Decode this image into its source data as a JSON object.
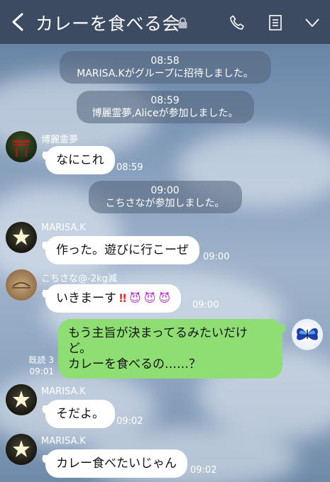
{
  "header": {
    "title": "カレーを食べる会"
  },
  "colors": {
    "header_bg": "#3c4a62",
    "bubble_self": "#8fde73",
    "bubble_other": "#ffffff"
  },
  "messages": {
    "sys1_time": "08:58",
    "sys1_text": "MARISA.Kがグループに招待しました。",
    "sys2_time": "08:59",
    "sys2_text": "博麗霊夢,Aliceが参加しました。",
    "m1_sender": "博麗霊夢",
    "m1_text": "なにこれ",
    "m1_time": "08:59",
    "sys3_time": "09:00",
    "sys3_text": "こちさなが参加しました。",
    "m2_sender": "MARISA.K",
    "m2_text": "作った。遊びに行こーぜ",
    "m2_time": "09:00",
    "m3_sender": "こちさな@-2kg減",
    "m3_text": "いきまーす",
    "m3_emoji1": "‼",
    "m3_emoji2": "😈",
    "m3_emoji3": "😈",
    "m3_emoji4": "😈",
    "m3_time": "09:00",
    "m4_line1": "もう主旨が決まってるみたいだけ",
    "m4_line2": "ど。",
    "m4_line3": "カレーを食べるの……？",
    "m4_read": "既読 3",
    "m4_time": "09:01",
    "m5_sender": "MARISA.K",
    "m5_text": "そだよ。",
    "m5_time": "09:02",
    "m6_sender": "MARISA.K",
    "m6_text": "カレー食べたいじゃん",
    "m6_time": "09:02"
  }
}
